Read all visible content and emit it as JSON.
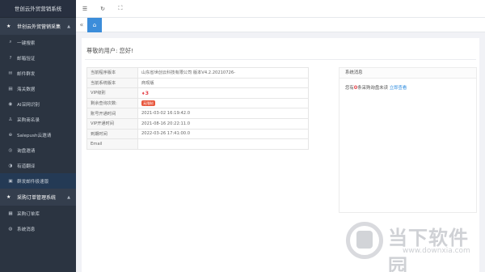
{
  "app": {
    "title": "世创云外贸营销系统"
  },
  "sidebar": {
    "group1": {
      "label": "世创云外贸营销采集"
    },
    "items": [
      {
        "label": "一键搜索",
        "icon": "search-icon"
      },
      {
        "label": "邮箱验证",
        "icon": "question-icon"
      },
      {
        "label": "邮件群发",
        "icon": "mail-icon"
      },
      {
        "label": "海关数据",
        "icon": "chart-icon"
      },
      {
        "label": "AI深网识别",
        "icon": "eye-icon"
      },
      {
        "label": "采购商名录",
        "icon": "user-icon"
      },
      {
        "label": "Salepush云邀请",
        "icon": "globe-icon"
      },
      {
        "label": "询盘邀请",
        "icon": "compass-icon"
      },
      {
        "label": "有道翻译",
        "icon": "translate-icon"
      },
      {
        "label": "群发邮件极速版",
        "icon": "list-icon"
      }
    ],
    "group2": {
      "label": "采购订单管理系统"
    },
    "items2": [
      {
        "label": "采购订单库",
        "icon": "folder-icon"
      },
      {
        "label": "系统消息",
        "icon": "bell-icon"
      }
    ]
  },
  "main": {
    "greeting": "尊敬的用户: 您好!",
    "rows": [
      {
        "label": "当前程序版本",
        "value": "山东省世创云科技有限公司 版本V4.2.20210726-"
      },
      {
        "label": "当前系统版本",
        "value": "商现版"
      },
      {
        "label": "VIP级别",
        "value": "3"
      },
      {
        "label": "剩余查询次数:",
        "value": "无限制"
      },
      {
        "label": "账号开通时间",
        "value": "2021-03-02 16:19:42.0"
      },
      {
        "label": "VIP开通时间",
        "value": "2021-08-16 20:22:11.0"
      },
      {
        "label": "到期时间",
        "value": "2022-03-26 17:41:00.0"
      },
      {
        "label": "Email",
        "value": ""
      }
    ]
  },
  "messages": {
    "title": "系统消息",
    "prefix": "您有",
    "count": "0",
    "suffix": "条采购询盘未读",
    "link": "立即查看"
  },
  "watermark": {
    "cn": "当下软件园",
    "en": "www.downxia.com"
  }
}
